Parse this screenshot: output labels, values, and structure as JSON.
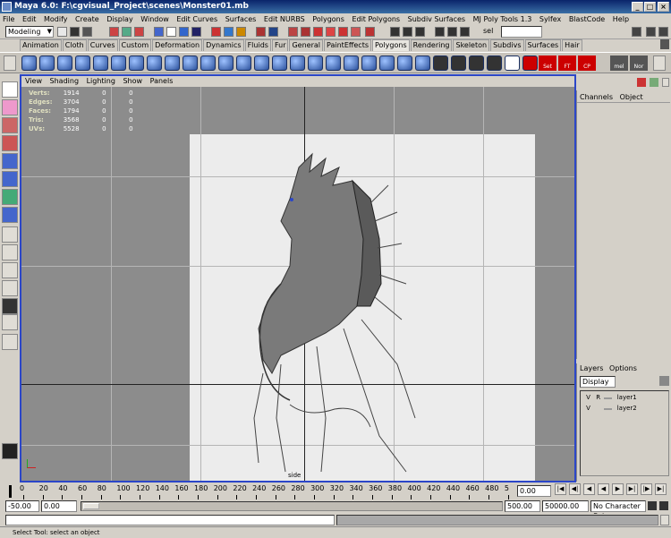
{
  "window": {
    "title": "Maya 6.0: F:\\cgvisual_Project\\scenes\\Monster01.mb"
  },
  "menubar": [
    "File",
    "Edit",
    "Modify",
    "Create",
    "Display",
    "Window",
    "Edit Curves",
    "Surfaces",
    "Edit NURBS",
    "Polygons",
    "Edit Polygons",
    "Subdiv Surfaces",
    "MJ Poly Tools 1.3",
    "Sylfex",
    "BlastCode",
    "Help"
  ],
  "statusline": {
    "mode": "Modeling",
    "sel_label": "sel"
  },
  "shelf_tabs": [
    "Animation",
    "Cloth",
    "Curves",
    "Custom",
    "Deformation",
    "Dynamics",
    "Fluids",
    "Fur",
    "General",
    "PaintEffects",
    "Polygons",
    "Rendering",
    "Skeleton",
    "Subdivs",
    "Surfaces",
    "Hair"
  ],
  "shelf_active": "Polygons",
  "shelf_text_buttons": [
    "Set",
    "FT",
    "CP",
    "mel",
    "Nor"
  ],
  "panel_menu": [
    "View",
    "Shading",
    "Lighting",
    "Show",
    "Panels"
  ],
  "hud": [
    {
      "label": "Verts:",
      "a": "1914",
      "b": "0",
      "c": "0"
    },
    {
      "label": "Edges:",
      "a": "3704",
      "b": "0",
      "c": "0"
    },
    {
      "label": "Faces:",
      "a": "1794",
      "b": "0",
      "c": "0"
    },
    {
      "label": "Tris:",
      "a": "3568",
      "b": "0",
      "c": "0"
    },
    {
      "label": "UVs:",
      "a": "5528",
      "b": "0",
      "c": "0"
    }
  ],
  "camera_label": "side",
  "channelbox": {
    "menu": [
      "Channels",
      "Object"
    ]
  },
  "layers": {
    "menu": [
      "Layers",
      "Options"
    ],
    "display": "Display",
    "rows": [
      {
        "v": "V",
        "r": "R",
        "name": "layer1"
      },
      {
        "v": "V",
        "r": "",
        "name": "layer2"
      }
    ]
  },
  "timeslider": {
    "ticks": [
      "0",
      "20",
      "40",
      "60",
      "80",
      "100",
      "120",
      "140",
      "160",
      "180",
      "200",
      "220",
      "240",
      "260",
      "280",
      "300",
      "320",
      "340",
      "360",
      "380",
      "400",
      "420",
      "440",
      "460",
      "480",
      "5"
    ],
    "current_time": "0.00"
  },
  "rangeslider": {
    "start": "-50.00",
    "inner_start": "0.00",
    "inner_end": "500.00",
    "end": "50000.00",
    "character_set": "No Character Set"
  },
  "helpline": "Select Tool: select an object",
  "colors": {
    "title_bar": "#0a246a",
    "panel_border": "#2b46c8",
    "viewport": "#8c8c8c"
  }
}
